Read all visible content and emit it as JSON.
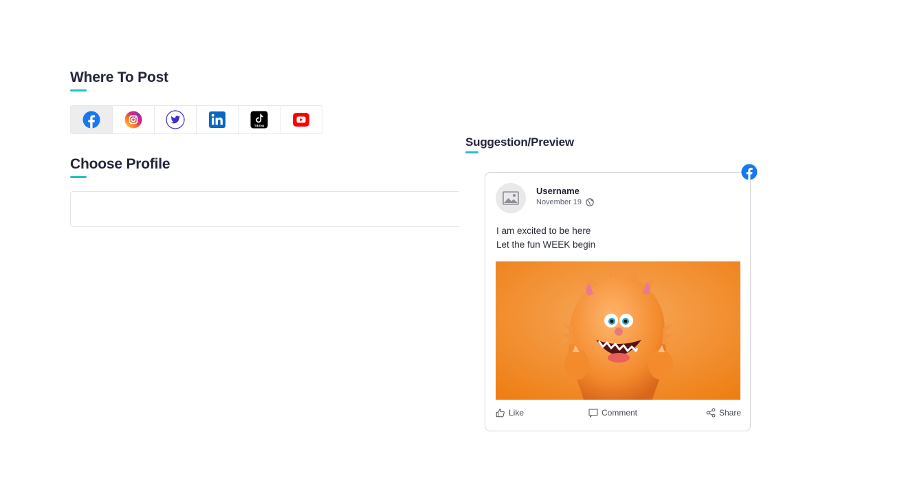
{
  "sections": {
    "where_to_post": "Where To Post",
    "choose_profile": "Choose Profile",
    "suggestion_preview": "Suggestion/Preview"
  },
  "platforms": [
    {
      "name": "facebook",
      "icon": "facebook-icon",
      "active": true,
      "color": "#1877f2"
    },
    {
      "name": "instagram",
      "icon": "instagram-icon",
      "active": false,
      "color": "#e1306c"
    },
    {
      "name": "twitter",
      "icon": "twitter-icon",
      "active": false,
      "color": "#3b2ed0"
    },
    {
      "name": "linkedin",
      "icon": "linkedin-icon",
      "active": false,
      "color": "#0a66c2"
    },
    {
      "name": "tiktok",
      "icon": "tiktok-icon",
      "active": false,
      "color": "#000000",
      "label": "TikTok"
    },
    {
      "name": "youtube",
      "icon": "youtube-icon",
      "active": false,
      "color": "#ff0000"
    }
  ],
  "profile_select": {
    "value": ""
  },
  "post": {
    "username": "Username",
    "date": "November 19",
    "lines": [
      "I am excited to be here",
      "Let the fun WEEK begin"
    ],
    "actions": {
      "like": "Like",
      "comment": "Comment",
      "share": "Share"
    }
  },
  "colors": {
    "accent": "#22c1c3",
    "facebook": "#1877f2"
  }
}
